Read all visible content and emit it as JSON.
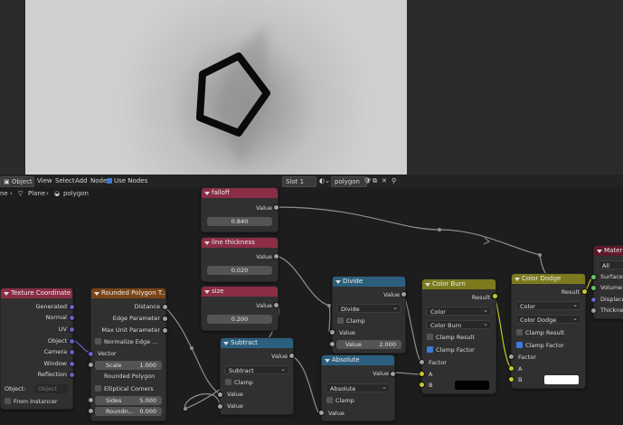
{
  "header": {
    "mode": "Object",
    "menus": [
      "View",
      "Select",
      "Add",
      "Node"
    ],
    "use_nodes": "Use Nodes",
    "slot": "Slot 1",
    "material": "polygon"
  },
  "breadcrumb": {
    "first": "ne",
    "object": "Plane",
    "material": "polygon"
  },
  "nodes": {
    "falloff": {
      "title": "falloff",
      "label": "Value",
      "value": "0.840"
    },
    "thickness": {
      "title": "line thickness",
      "label": "Value",
      "value": "0.020"
    },
    "size": {
      "title": "size",
      "label": "Value",
      "value": "0.200"
    },
    "texcoord": {
      "title": "Texture Coordinate",
      "outputs": [
        "Generated",
        "Normal",
        "UV",
        "Object",
        "Camera",
        "Window",
        "Reflection"
      ],
      "object_label": "Object:",
      "object_placeholder": "Object",
      "from_instancer": "From Instancer"
    },
    "rounded": {
      "title": "Rounded Polygon T...",
      "outputs": [
        "Distance",
        "Edge Parameter",
        "Max Unit Parameter"
      ],
      "normalize": "Normalize Edge ...",
      "vector": "Vector",
      "scale_label": "Scale",
      "scale_value": "1.000",
      "sub_title": "Rounded Polygon",
      "elliptical": "Elliptical Corners",
      "sides_label": "Sides",
      "sides_value": "5.000",
      "round_label": "Roundn...",
      "round_value": "0.000"
    },
    "subtract": {
      "title": "Subtract",
      "out": "Value",
      "op": "Subtract",
      "clamp": "Clamp",
      "in1": "Value",
      "in2": "Value"
    },
    "divide": {
      "title": "Divide",
      "out": "Value",
      "op": "Divide",
      "clamp": "Clamp",
      "in1": "Value",
      "in2": "Value",
      "in2_value": "2.000"
    },
    "absolute": {
      "title": "Absolute",
      "out": "Value",
      "op": "Absolute",
      "clamp": "Clamp",
      "in1": "Value"
    },
    "burn": {
      "title": "Color Burn",
      "out": "Result",
      "type": "Color",
      "mode": "Color Burn",
      "clamp_result": "Clamp Result",
      "clamp_factor": "Clamp Factor",
      "factor": "Factor",
      "a": "A",
      "b": "B"
    },
    "dodge": {
      "title": "Color Dodge",
      "out": "Result",
      "type": "Color",
      "mode": "Color Dodge",
      "clamp_result": "Clamp Result",
      "clamp_factor": "Clamp Factor",
      "factor": "Factor",
      "a": "A",
      "b": "B"
    },
    "output": {
      "title": "Mater",
      "target": "All",
      "inputs": [
        "Surface",
        "Volume",
        "Displace",
        "Thickness"
      ]
    }
  },
  "colors": {
    "math_header": "#2c5f7e",
    "input_header": "#8a2d45",
    "vector_header": "#7a4417",
    "mix_header": "#7b7b1e",
    "output_header": "#5e1a29"
  }
}
